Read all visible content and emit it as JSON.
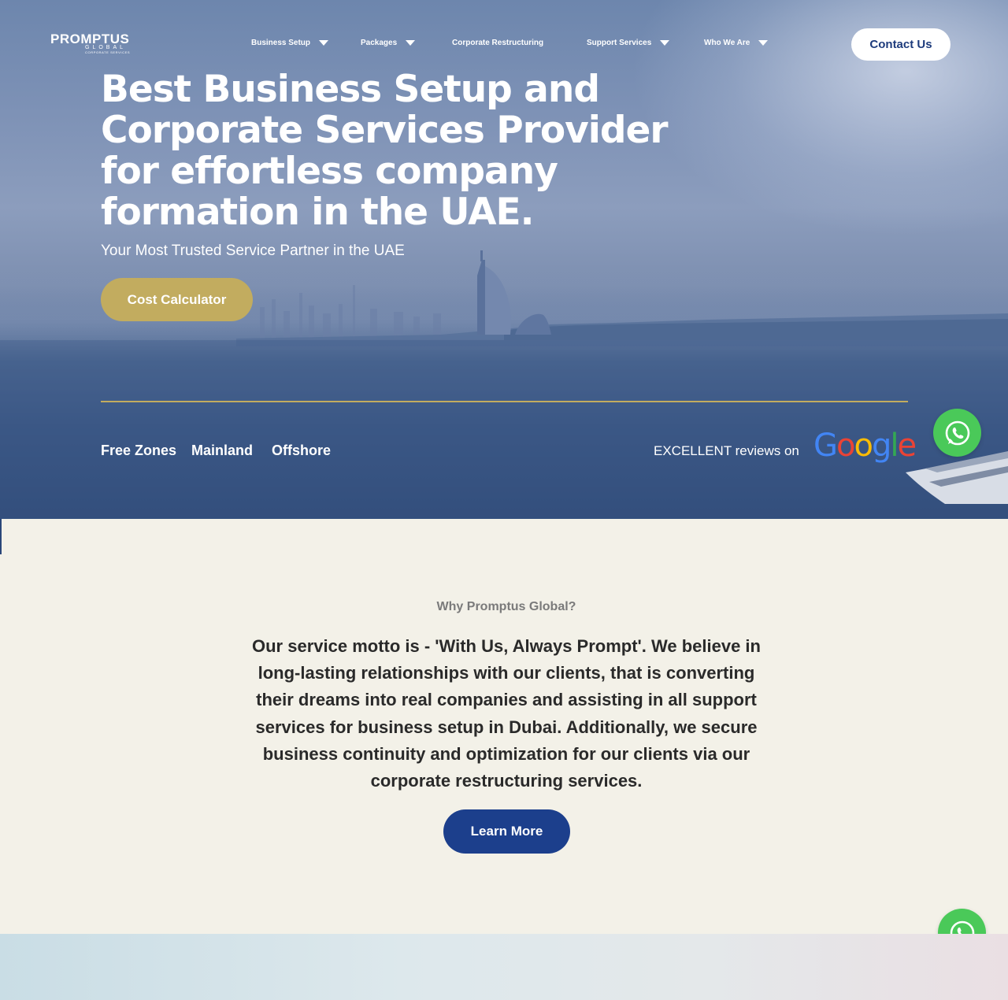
{
  "header": {
    "logo_text": "PROMPTUS",
    "logo_sub": "GLOBAL",
    "logo_tagline": "CORPORATE SERVICES",
    "nav": [
      {
        "label": "Business Setup",
        "has_dropdown": true
      },
      {
        "label": "Packages",
        "has_dropdown": true
      },
      {
        "label": "Corporate Restructuring",
        "has_dropdown": false
      },
      {
        "label": "Support Services",
        "has_dropdown": true
      },
      {
        "label": "Who We Are",
        "has_dropdown": true
      }
    ],
    "contact_label": "Contact Us"
  },
  "hero": {
    "title": "Best Business Setup and Corporate Services Provider for effortless company formation in the UAE.",
    "subtitle": "Your Most Trusted Service Partner in the UAE",
    "cta_label": "Cost Calculator",
    "links": [
      "Free Zones",
      "Mainland",
      "Offshore"
    ],
    "reviews_text": "EXCELLENT reviews on",
    "reviews_brand": "Google"
  },
  "why": {
    "eyebrow": "Why Promptus Global?",
    "body": "Our service motto is - 'With Us, Always Prompt'. We believe in long-lasting relationships with our clients, that is converting their dreams into real companies and assisting in all support services for business setup in Dubai. Additionally, we secure business continuity and optimization for our clients via our corporate restructuring services.",
    "cta_label": "Learn More"
  },
  "colors": {
    "gold": "#c2ac5f",
    "navy": "#1c3f8c",
    "whatsapp": "#4ac959",
    "section_bg": "#f3f1e8"
  },
  "icons": {
    "whatsapp": "whatsapp-icon",
    "dropdown": "chevron-down-icon"
  }
}
